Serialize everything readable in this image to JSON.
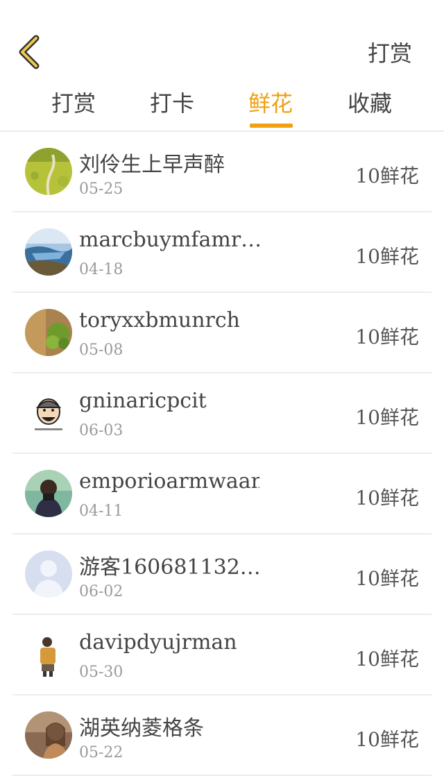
{
  "header": {
    "reward_link": "打赏"
  },
  "tabs": [
    {
      "label": "打赏"
    },
    {
      "label": "打卡"
    },
    {
      "label": "鲜花"
    },
    {
      "label": "收藏"
    }
  ],
  "active_tab": "鲜花",
  "colors": {
    "accent": "#f0a010",
    "divider": "#ececec"
  },
  "rows": [
    {
      "name": "刘伶生上早声醉",
      "date": "05-25",
      "amount": "10鲜花"
    },
    {
      "name": "marcbuymfamr…",
      "date": "04-18",
      "amount": "10鲜花"
    },
    {
      "name": "toryxxbmunrch",
      "date": "05-08",
      "amount": "10鲜花"
    },
    {
      "name": "gninaricpcit",
      "date": "06-03",
      "amount": "10鲜花"
    },
    {
      "name": "emporioarmwaani",
      "date": "04-11",
      "amount": "10鲜花"
    },
    {
      "name": "游客160681132…",
      "date": "06-02",
      "amount": "10鲜花"
    },
    {
      "name": "davipdyujrman",
      "date": "05-30",
      "amount": "10鲜花"
    },
    {
      "name": "湖英纳菱格条",
      "date": "05-22",
      "amount": "10鲜花"
    }
  ]
}
